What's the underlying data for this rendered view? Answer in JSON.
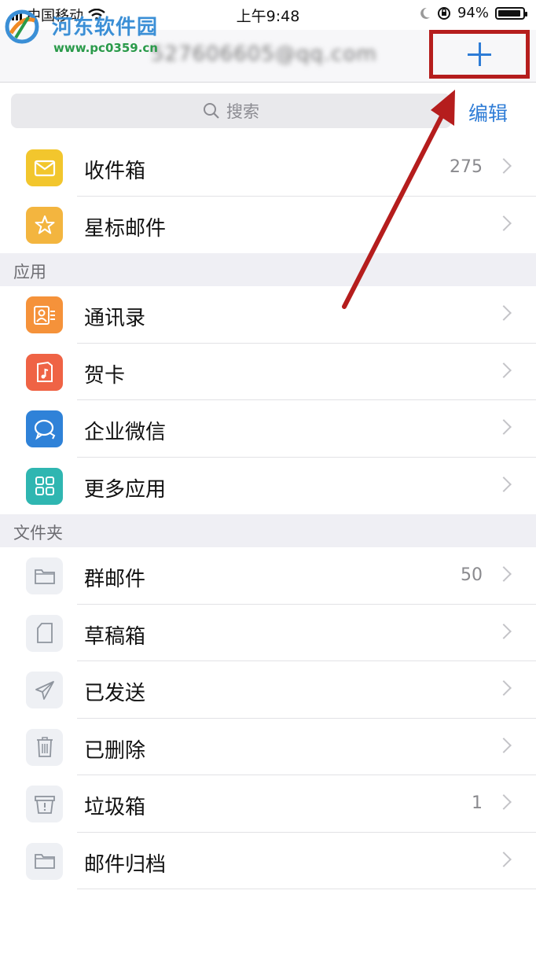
{
  "watermark": {
    "title": "河东软件园",
    "url": "www.pc0359.cn"
  },
  "status_bar": {
    "carrier": "中国移动",
    "time": "上午9:48",
    "battery": "94%",
    "battery_level": 0.94
  },
  "nav": {
    "account": "527606605@qq.com",
    "add_icon": "plus-icon"
  },
  "search": {
    "placeholder": "搜索",
    "edit_label": "编辑"
  },
  "mailboxes": [
    {
      "label": "收件箱",
      "count": "275",
      "icon": "inbox-icon"
    },
    {
      "label": "星标邮件",
      "count": "",
      "icon": "star-icon"
    }
  ],
  "apps_section": {
    "title": "应用",
    "items": [
      {
        "label": "通讯录",
        "icon": "contacts-icon"
      },
      {
        "label": "贺卡",
        "icon": "greeting-card-icon"
      },
      {
        "label": "企业微信",
        "icon": "wework-icon"
      },
      {
        "label": "更多应用",
        "icon": "more-apps-icon"
      }
    ]
  },
  "folders_section": {
    "title": "文件夹",
    "items": [
      {
        "label": "群邮件",
        "count": "50",
        "icon": "folder-icon"
      },
      {
        "label": "草稿箱",
        "count": "",
        "icon": "draft-icon"
      },
      {
        "label": "已发送",
        "count": "",
        "icon": "sent-icon"
      },
      {
        "label": "已删除",
        "count": "",
        "icon": "trash-icon"
      },
      {
        "label": "垃圾箱",
        "count": "1",
        "icon": "spam-icon"
      },
      {
        "label": "邮件归档",
        "count": "",
        "icon": "archive-folder-icon"
      }
    ]
  },
  "colors": {
    "accent": "#2e7cd6",
    "highlight_box": "#b51d1d",
    "inbox": "#f2c62d",
    "starred": "#f3b53f",
    "contacts": "#f5923a",
    "card": "#ef6345",
    "wework": "#2f82d8",
    "more_apps": "#2fb6b1"
  }
}
